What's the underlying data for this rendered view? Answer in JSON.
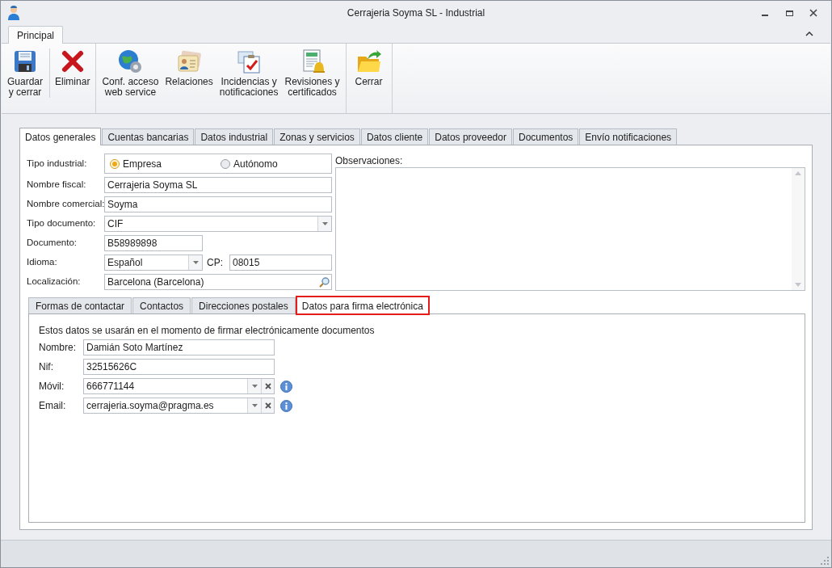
{
  "window": {
    "title": "Cerrajeria Soyma SL - Industrial"
  },
  "ribbon": {
    "tabs": [
      {
        "label": "Principal",
        "selected": true
      }
    ],
    "groups": [
      {
        "buttons": [
          {
            "label": "Guardar\ny cerrar"
          },
          {
            "label": "Eliminar"
          }
        ]
      },
      {
        "buttons": [
          {
            "label": "Conf. acceso\nweb service"
          },
          {
            "label": "Relaciones"
          },
          {
            "label": "Incidencias y\nnotificaciones"
          },
          {
            "label": "Revisiones y\ncertificados"
          }
        ]
      },
      {
        "buttons": [
          {
            "label": "Cerrar"
          }
        ]
      }
    ]
  },
  "tabs": [
    {
      "label": "Datos generales",
      "selected": true
    },
    {
      "label": "Cuentas bancarias",
      "selected": false
    },
    {
      "label": "Datos industrial",
      "selected": false
    },
    {
      "label": "Zonas y servicios",
      "selected": false
    },
    {
      "label": "Datos cliente",
      "selected": false
    },
    {
      "label": "Datos proveedor",
      "selected": false
    },
    {
      "label": "Documentos",
      "selected": false
    },
    {
      "label": "Envío notificaciones",
      "selected": false
    }
  ],
  "general": [
    {
      "kind": "radio",
      "label": "Tipo industrial:",
      "options": [
        {
          "label": "Empresa",
          "selected": true
        },
        {
          "label": "Autónomo",
          "selected": false
        }
      ]
    },
    {
      "kind": "text",
      "label": "Nombre fiscal:",
      "value": "Cerrajeria Soyma SL"
    },
    {
      "kind": "text",
      "label": "Nombre comercial:",
      "value": "Soyma"
    },
    {
      "kind": "combo",
      "label": "Tipo documento:",
      "value": "CIF"
    },
    {
      "kind": "short",
      "label": "Documento:",
      "value": "B58989898"
    },
    {
      "kind": "pair",
      "label": "Idioma:",
      "value": "Español",
      "label2": "CP:",
      "value2": "08015"
    },
    {
      "kind": "search",
      "label": "Localización:",
      "value": "Barcelona (Barcelona)"
    }
  ],
  "observaciones": {
    "label": "Observaciones:"
  },
  "subtabs": [
    {
      "label": "Formas de contactar",
      "selected": false,
      "highlighted": false
    },
    {
      "label": "Contactos",
      "selected": false,
      "highlighted": false
    },
    {
      "label": "Direcciones postales",
      "selected": false,
      "highlighted": false
    },
    {
      "label": "Datos para firma electrónica",
      "selected": true,
      "highlighted": true
    }
  ],
  "firma": {
    "description": "Estos datos se usarán en el momento de firmar electrónicamente documentos",
    "fields": [
      {
        "kind": "text",
        "label": "Nombre:",
        "value": "Damián Soto Martínez"
      },
      {
        "kind": "text",
        "label": "Nif:",
        "value": "32515626C"
      },
      {
        "kind": "combo_clear",
        "label": "Móvil:",
        "value": "666771144"
      },
      {
        "kind": "combo_clear",
        "label": "Email:",
        "value": "cerrajeria.soyma@pragma.es"
      }
    ]
  }
}
